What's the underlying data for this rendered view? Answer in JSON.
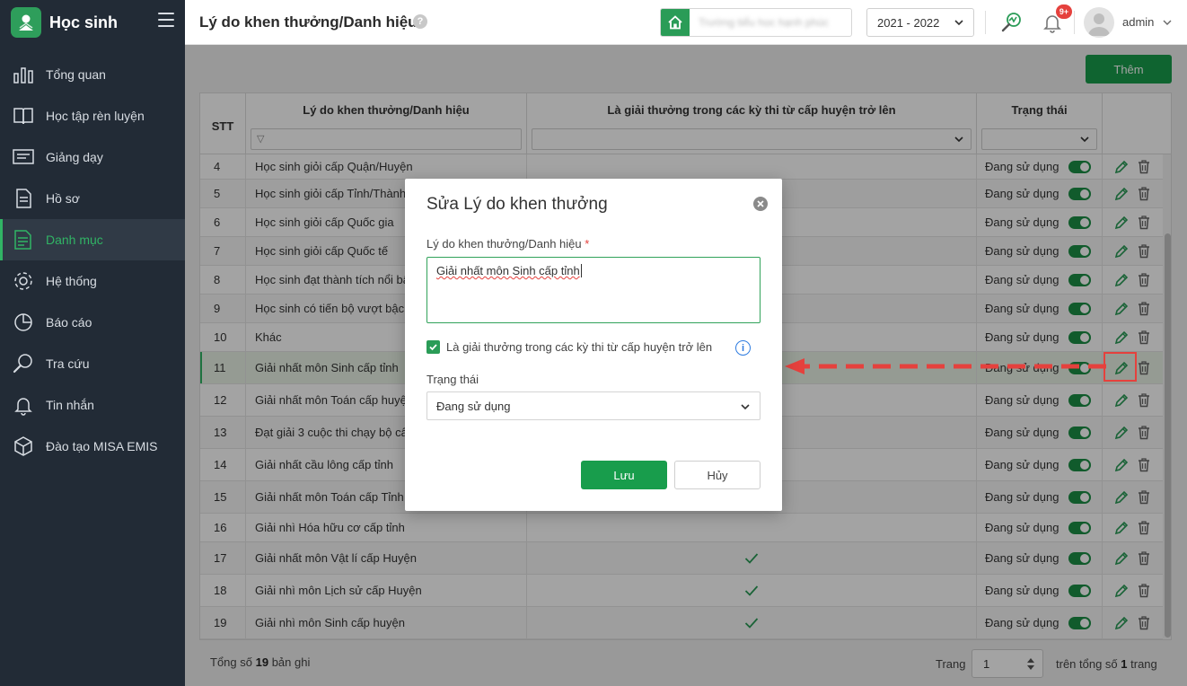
{
  "sidebar": {
    "app_title": "Học sinh",
    "items": [
      {
        "label": "Tổng quan",
        "icon": "chart-bars-icon"
      },
      {
        "label": "Học tập rèn luyện",
        "icon": "book-icon"
      },
      {
        "label": "Giảng dạy",
        "icon": "board-icon"
      },
      {
        "label": "Hồ sơ",
        "icon": "document-icon"
      },
      {
        "label": "Danh mục",
        "icon": "folder-list-icon",
        "active": true
      },
      {
        "label": "Hệ thống",
        "icon": "gear-icon"
      },
      {
        "label": "Báo cáo",
        "icon": "pie-chart-icon"
      },
      {
        "label": "Tra cứu",
        "icon": "search-icon"
      },
      {
        "label": "Tin nhắn",
        "icon": "bell-icon"
      },
      {
        "label": "Đào tạo MISA EMIS",
        "icon": "cube-icon"
      }
    ]
  },
  "header": {
    "title": "Lý do khen thưởng/Danh hiệu",
    "help_glyph": "?",
    "school_name": "Trường tiểu học hạnh phúc",
    "school_year": "2021 - 2022",
    "notification_badge": "9+",
    "user": "admin"
  },
  "toolbar": {
    "add_label": "Thêm"
  },
  "table": {
    "headers": {
      "stt": "STT",
      "name": "Lý do khen thưởng/Danh hiệu",
      "award": "Là giải thưởng trong các kỳ thi từ cấp huyện trở lên",
      "status": "Trạng thái"
    },
    "filter_glyph": "▽",
    "check_glyph": "✓",
    "rows": [
      {
        "stt": "4",
        "name": "Học sinh giỏi cấp Quận/Huyện",
        "award": "",
        "status": "Đang sử dụng"
      },
      {
        "stt": "5",
        "name": "Học sinh giỏi cấp Tỉnh/Thành phố",
        "award": "",
        "status": "Đang sử dụng"
      },
      {
        "stt": "6",
        "name": "Học sinh giỏi cấp Quốc gia",
        "award": "",
        "status": "Đang sử dụng"
      },
      {
        "stt": "7",
        "name": "Học sinh giỏi cấp Quốc tế",
        "award": "",
        "status": "Đang sử dụng"
      },
      {
        "stt": "8",
        "name": "Học sinh đạt thành tích nổi bật",
        "award": "",
        "status": "Đang sử dụng"
      },
      {
        "stt": "9",
        "name": "Học sinh có tiến bộ vượt bậc",
        "award": "",
        "status": "Đang sử dụng"
      },
      {
        "stt": "10",
        "name": "Khác",
        "award": "",
        "status": "Đang sử dụng"
      },
      {
        "stt": "11",
        "name": "Giải nhất môn Sinh cấp tỉnh",
        "award": "",
        "status": "Đang sử dụng",
        "highlighted": true
      },
      {
        "stt": "12",
        "name": "Giải nhất môn Toán cấp huyện",
        "award": "",
        "status": "Đang sử dụng"
      },
      {
        "stt": "13",
        "name": "Đạt giải 3 cuộc thi chạy bộ cấp tỉnh",
        "award": "",
        "status": "Đang sử dụng"
      },
      {
        "stt": "14",
        "name": "Giải nhất cầu lông cấp tỉnh",
        "award": "",
        "status": "Đang sử dụng"
      },
      {
        "stt": "15",
        "name": "Giải nhất môn Toán cấp Tỉnh",
        "award": "",
        "status": "Đang sử dụng"
      },
      {
        "stt": "16",
        "name": "Giải nhì Hóa hữu cơ cấp tỉnh",
        "award": "",
        "status": "Đang sử dụng"
      },
      {
        "stt": "17",
        "name": "Giải nhất môn Vật lí cấp Huyện",
        "award": "✓",
        "status": "Đang sử dụng"
      },
      {
        "stt": "18",
        "name": "Giải nhì môn Lịch sử cấp Huyện",
        "award": "✓",
        "status": "Đang sử dụng"
      },
      {
        "stt": "19",
        "name": "Giải nhì môn Sinh cấp huyện",
        "award": "✓",
        "status": "Đang sử dụng"
      }
    ]
  },
  "footer": {
    "total_prefix": "Tổng số",
    "total_count": "19",
    "total_suffix": "bản ghi",
    "page_label": "Trang",
    "page_value": "1",
    "page_of_prefix": "trên tổng số",
    "page_total": "1",
    "page_of_suffix": "trang"
  },
  "modal": {
    "title": "Sửa Lý do khen thưởng",
    "name_label": "Lý do khen thưởng/Danh hiệu",
    "required_mark": "*",
    "name_value": "Giải nhất môn Sinh cấp tỉnh",
    "checkbox_label": "Là giải thưởng trong các kỳ thi từ cấp huyện trở lên",
    "checkbox_checked": true,
    "info_glyph": "i",
    "status_label": "Trạng thái",
    "status_value": "Đang sử dụng",
    "save_label": "Lưu",
    "cancel_label": "Hủy"
  },
  "colors": {
    "primary": "#189d4c",
    "sidebar_bg": "#222b36",
    "active": "#31b465",
    "annotation": "#e5413d"
  }
}
